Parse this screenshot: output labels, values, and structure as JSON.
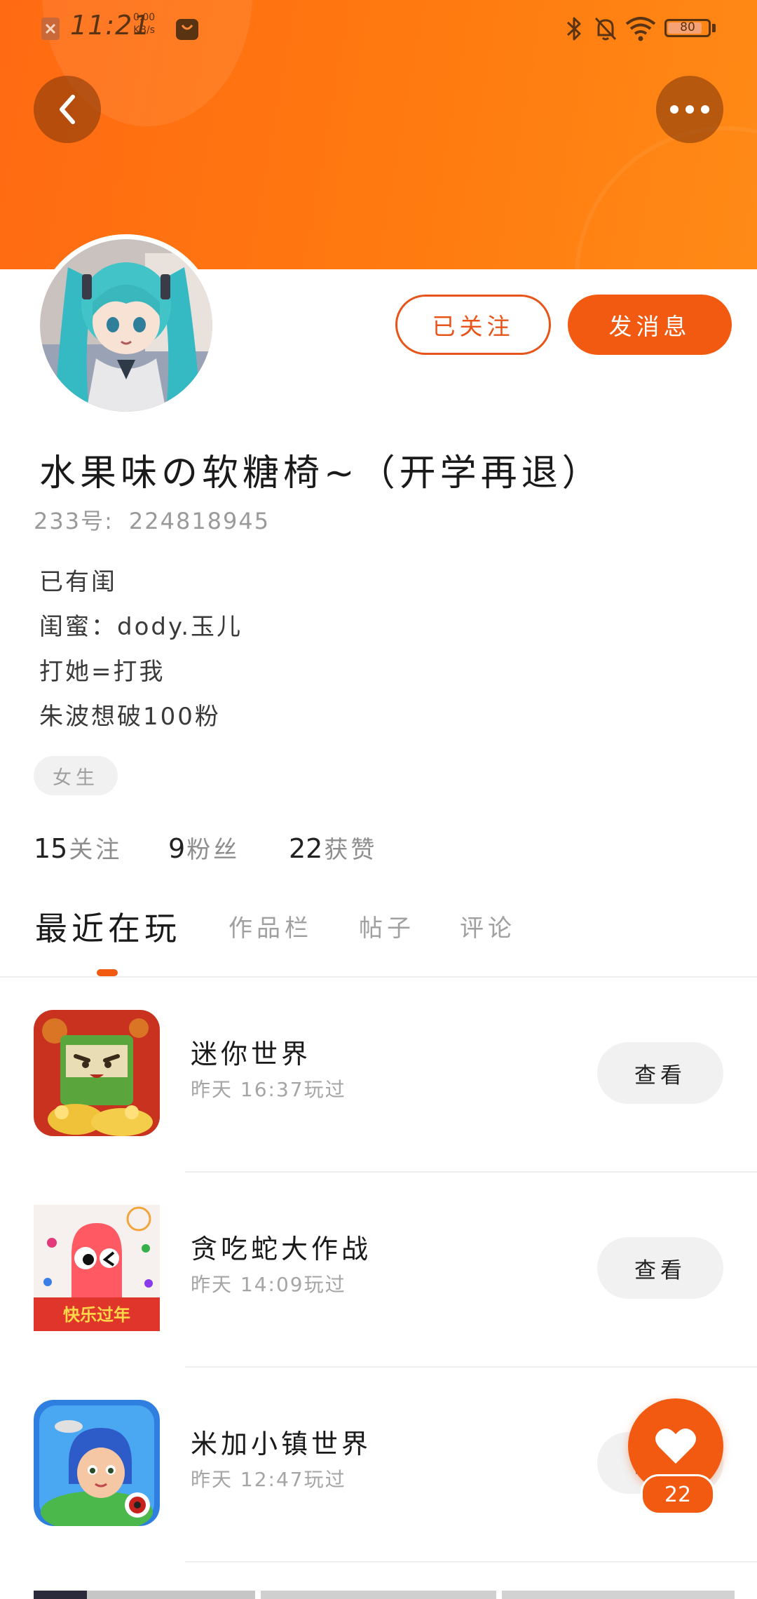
{
  "status_bar": {
    "time": "11:21",
    "net_speed_value": "0.00",
    "net_speed_unit": "KB/s",
    "battery_level": "80",
    "icons": [
      "close-notification-icon",
      "shopping-bag-icon",
      "bluetooth-icon",
      "bell-muted-icon",
      "wifi-icon",
      "battery-icon"
    ]
  },
  "header": {
    "back_icon": "chevron-left-icon",
    "more_icon": "more-dots-icon"
  },
  "profile": {
    "follow_label": "已关注",
    "message_label": "发消息",
    "nickname": "水果味の软糖椅~（开学再退）",
    "uid_label": "233号:",
    "uid_value": "224818945",
    "bio": [
      "已有闺",
      "闺蜜：dody.玉儿",
      "打她=打我",
      "朱波想破100粉"
    ],
    "gender_tag": "女生",
    "stats": {
      "following_count": "15",
      "following_label": "关注",
      "fans_count": "9",
      "fans_label": "粉丝",
      "likes_count": "22",
      "likes_label": "获赞"
    }
  },
  "tabs": {
    "recent": "最近在玩",
    "works": "作品栏",
    "posts": "帖子",
    "comments": "评论"
  },
  "games": [
    {
      "name": "迷你世界",
      "played": "昨天 16:37玩过",
      "button": "查看"
    },
    {
      "name": "贪吃蛇大作战",
      "played": "昨天 14:09玩过",
      "button": "查看"
    },
    {
      "name": "米加小镇世界",
      "played": "昨天 12:47玩过",
      "button": "查看"
    }
  ],
  "game_icon_text": {
    "snake_banner": "快乐过年"
  },
  "like_fab": {
    "count": "22",
    "icon": "heart-icon"
  },
  "colors": {
    "accent": "#f25a12",
    "header": "#ff7a10",
    "muted_text": "#a0a0a0"
  }
}
